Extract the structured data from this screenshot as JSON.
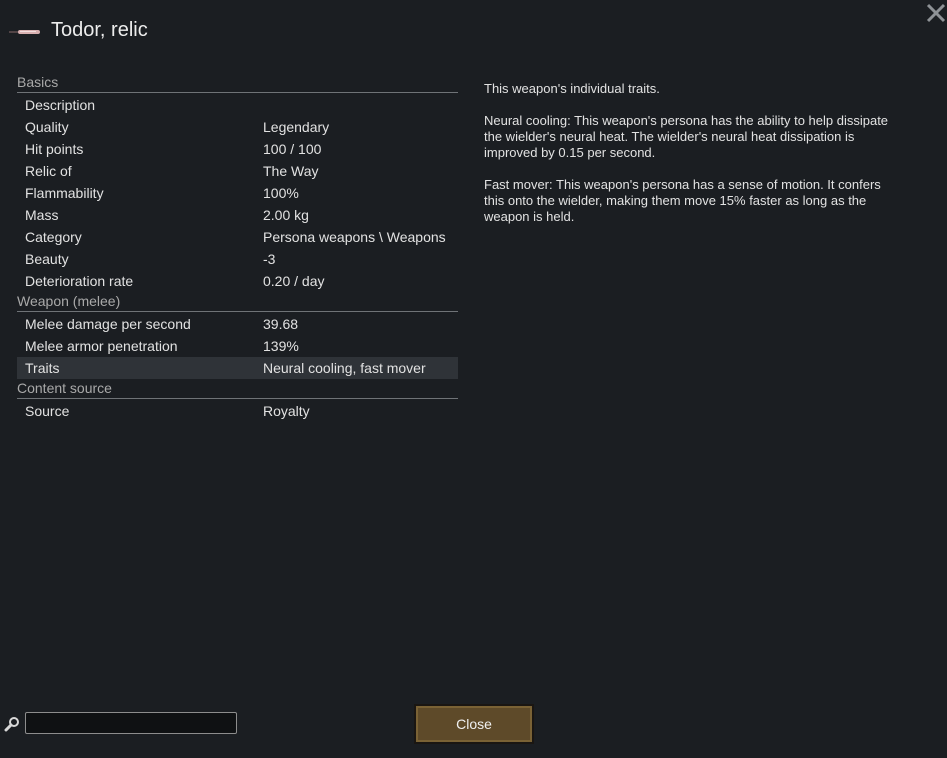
{
  "window": {
    "title": "Todor, relic",
    "close_icon": "close-x-icon",
    "item_icon": "relic-weapon-icon"
  },
  "sections": [
    {
      "header": "Basics",
      "rows": [
        {
          "label": "Description",
          "value": ""
        },
        {
          "label": "Quality",
          "value": "Legendary"
        },
        {
          "label": "Hit points",
          "value": "100 / 100"
        },
        {
          "label": "Relic of",
          "value": "The Way"
        },
        {
          "label": "Flammability",
          "value": "100%"
        },
        {
          "label": "Mass",
          "value": "2.00 kg"
        },
        {
          "label": "Category",
          "value": "Persona weapons \\ Weapons"
        },
        {
          "label": "Beauty",
          "value": "-3"
        },
        {
          "label": "Deterioration rate",
          "value": "0.20 / day"
        }
      ]
    },
    {
      "header": "Weapon (melee)",
      "rows": [
        {
          "label": "Melee damage per second",
          "value": "39.68"
        },
        {
          "label": "Melee armor penetration",
          "value": "139%"
        },
        {
          "label": "Traits",
          "value": "Neural cooling, fast mover",
          "selected": true
        }
      ]
    },
    {
      "header": "Content source",
      "rows": [
        {
          "label": "Source",
          "value": "Royalty"
        }
      ]
    }
  ],
  "description": {
    "paragraphs": [
      "This weapon's individual traits.",
      "Neural cooling: This weapon's persona has the ability to help dissipate the wielder's neural heat. The wielder's neural heat dissipation is improved by 0.15 per second.",
      "Fast mover: This weapon's persona has a sense of motion. It confers this onto the wielder, making them move 15% faster as long as the weapon is held."
    ]
  },
  "footer": {
    "search_icon": "search-icon",
    "search_value": "",
    "close_label": "Close"
  },
  "colors": {
    "background": "#1b1e22",
    "selected_row": "#2f3338",
    "close_button": "#5e4a29"
  }
}
